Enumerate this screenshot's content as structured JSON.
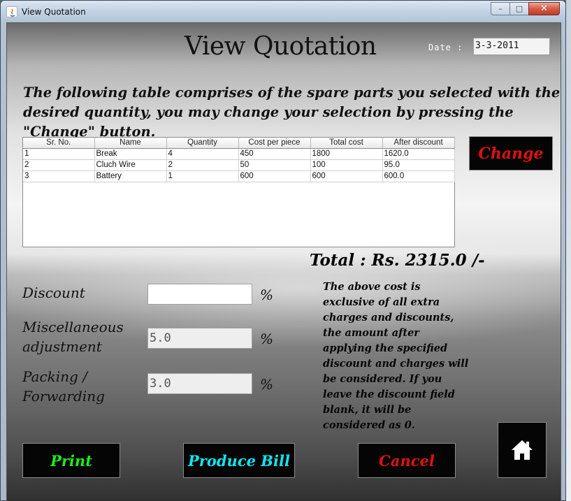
{
  "window": {
    "title": "View Quotation",
    "controls": {
      "minimize": "–",
      "maximize": "□",
      "close": "✕"
    }
  },
  "header": {
    "title": "View Quotation",
    "date_label": "Date :",
    "date_value": "3-3-2011"
  },
  "intro_text": "The following table comprises of the spare parts you selected with the desired quantity, you may change your selection by pressing the \"Change\" button.",
  "table": {
    "columns": [
      "Sr. No.",
      "Name",
      "Quantity",
      "Cost per piece",
      "Total cost",
      "After discount"
    ],
    "rows": [
      [
        "1",
        "Break",
        "4",
        "450",
        "1800",
        "1620.0"
      ],
      [
        "2",
        "Cluch Wire",
        "2",
        "50",
        "100",
        "95.0"
      ],
      [
        "3",
        "Battery",
        "1",
        "600",
        "600",
        "600.0"
      ]
    ]
  },
  "buttons": {
    "change": "Change",
    "print": "Print",
    "produce_bill": "Produce Bill",
    "cancel": "Cancel",
    "home_icon": "home-icon"
  },
  "total_text": "Total : Rs. 2315.0 /-",
  "form": {
    "discount_label": "Discount",
    "discount_value": "",
    "misc_label_line1": "Miscellaneous",
    "misc_label_line2": "adjustment",
    "misc_value": "5.0",
    "packing_label_line1": "Packing /",
    "packing_label_line2": "Forwarding",
    "packing_value": "3.0",
    "percent": "%"
  },
  "note_text": "The above cost is exclusive of all extra charges and discounts, the amount after applying the specified discount and charges will be considered. If you leave the discount field blank, it will be considered as 0.",
  "colors": {
    "change_text": "#e01010",
    "print_text": "#18f018",
    "produce_bill_text": "#10e6f0",
    "cancel_text": "#e01010"
  }
}
